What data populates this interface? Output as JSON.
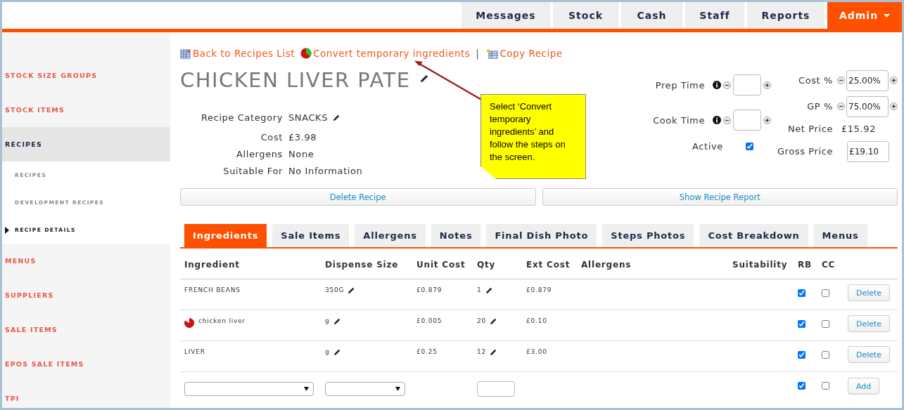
{
  "nav": [
    {
      "label": "Messages",
      "selected": false,
      "caret": false
    },
    {
      "label": "Stock",
      "selected": false,
      "caret": false
    },
    {
      "label": "Cash",
      "selected": false,
      "caret": false
    },
    {
      "label": "Staff",
      "selected": false,
      "caret": false
    },
    {
      "label": "Reports",
      "selected": false,
      "caret": false
    },
    {
      "label": "Admin",
      "selected": true,
      "caret": true
    }
  ],
  "sidebar": {
    "items": [
      {
        "label": "STOCK SIZE GROUPS",
        "kind": "main",
        "selected": false
      },
      {
        "label": "STOCK ITEMS",
        "kind": "main",
        "selected": false
      },
      {
        "label": "RECIPES",
        "kind": "main",
        "selected": true
      },
      {
        "label": "RECIPES",
        "kind": "sub",
        "selected": false
      },
      {
        "label": "DEVELOPMENT RECIPES",
        "kind": "sub",
        "selected": false
      },
      {
        "label": "RECIPE DETAILS",
        "kind": "sub",
        "selected": true
      },
      {
        "label": "MENUS",
        "kind": "main",
        "selected": false
      },
      {
        "label": "SUPPLIERS",
        "kind": "main",
        "selected": false
      },
      {
        "label": "SALE ITEMS",
        "kind": "main",
        "selected": false
      },
      {
        "label": "EPOS SALE ITEMS",
        "kind": "main",
        "selected": false
      },
      {
        "label": "TPI",
        "kind": "main",
        "selected": false
      }
    ]
  },
  "links": [
    {
      "label": "Back to Recipes List",
      "kind": "list"
    },
    {
      "label": "Convert temporary ingredients",
      "kind": "pie"
    },
    {
      "label": "Copy Recipe",
      "kind": "copy"
    }
  ],
  "link_separator": "|",
  "recipe": {
    "title": "CHICKEN LIVER PATE",
    "fields": [
      {
        "label": "Recipe Category",
        "value": "SNACKS",
        "editable": true
      },
      {
        "label": "Cost",
        "value": "£3.98",
        "editable": false
      },
      {
        "label": "Allergens",
        "value": "None",
        "editable": false
      },
      {
        "label": "Suitable For",
        "value": "No Information",
        "editable": false
      }
    ]
  },
  "times": [
    {
      "label": "Prep Time"
    },
    {
      "label": "Cook Time"
    }
  ],
  "active": {
    "label": "Active",
    "checked": true
  },
  "pricing": [
    {
      "label": "Cost %",
      "kind": "stepper",
      "value": "25.00%"
    },
    {
      "label": "GP %",
      "kind": "stepper",
      "value": "75.00%"
    },
    {
      "label": "Net Price",
      "kind": "text",
      "value": "£15.92"
    },
    {
      "label": "Gross Price",
      "kind": "input",
      "value": "£19.10"
    }
  ],
  "buttons": [
    "Delete Recipe",
    "Show Recipe Report"
  ],
  "tabs": [
    {
      "label": "Ingredients",
      "selected": true
    },
    {
      "label": "Sale Items",
      "selected": false
    },
    {
      "label": "Allergens",
      "selected": false
    },
    {
      "label": "Notes",
      "selected": false
    },
    {
      "label": "Final Dish Photo",
      "selected": false
    },
    {
      "label": "Steps Photos",
      "selected": false
    },
    {
      "label": "Cost Breakdown",
      "selected": false
    },
    {
      "label": "Menus",
      "selected": false
    }
  ],
  "table": {
    "columns": [
      "Ingredient",
      "Dispense Size",
      "Unit Cost",
      "Qty",
      "Ext Cost",
      "Allergens",
      "Suitability",
      "RB",
      "CC"
    ],
    "rows": [
      {
        "ingredient": "FRENCH BEANS",
        "temporary": false,
        "dispense_size": "350G",
        "unit_cost": "£0.879",
        "qty": "1",
        "ext_cost": "£0.879",
        "rb": true,
        "cc": false,
        "action": "Delete"
      },
      {
        "ingredient": "chicken liver",
        "temporary": true,
        "dispense_size": "g",
        "unit_cost": "£0.005",
        "qty": "20",
        "ext_cost": "£0.10",
        "rb": true,
        "cc": false,
        "action": "Delete"
      },
      {
        "ingredient": "LIVER",
        "temporary": false,
        "dispense_size": "g",
        "unit_cost": "£0.25",
        "qty": "12",
        "ext_cost": "£3.00",
        "rb": true,
        "cc": false,
        "action": "Delete"
      }
    ],
    "add_row": {
      "rb": true,
      "cc": false,
      "action": "Add"
    }
  },
  "callout": {
    "text": "Select ‘Convert temporary ingredients’ and follow the steps on the screen."
  }
}
